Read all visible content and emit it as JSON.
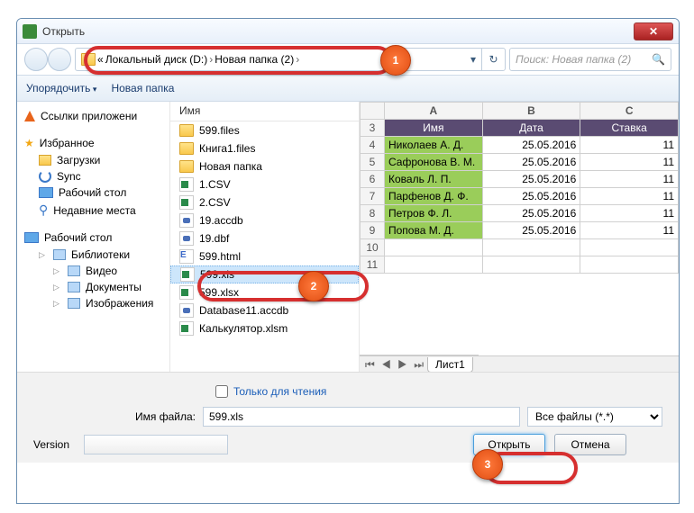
{
  "window": {
    "title": "Открыть"
  },
  "nav": {
    "prefix": "«",
    "seg1": "Локальный диск (D:)",
    "seg2": "Новая папка (2)",
    "sep": "›",
    "search_placeholder": "Поиск: Новая папка (2)"
  },
  "toolbar": {
    "organize": "Упорядочить",
    "newfolder": "Новая папка"
  },
  "sidebar": {
    "apps_header": "Ссылки приложени",
    "fav_header": "Избранное",
    "downloads": "Загрузки",
    "sync": "Sync",
    "desktop": "Рабочий стол",
    "recent": "Недавние места",
    "desk_header": "Рабочий стол",
    "libraries": "Библиотеки",
    "video": "Видео",
    "documents": "Документы",
    "pictures": "Изображения"
  },
  "filelist": {
    "col_name": "Имя",
    "rows": [
      {
        "icon": "folder",
        "name": "599.files"
      },
      {
        "icon": "folder",
        "name": "Книга1.files"
      },
      {
        "icon": "folder",
        "name": "Новая папка"
      },
      {
        "icon": "csv",
        "name": "1.CSV"
      },
      {
        "icon": "csv",
        "name": "2.CSV"
      },
      {
        "icon": "db",
        "name": "19.accdb"
      },
      {
        "icon": "db",
        "name": "19.dbf"
      },
      {
        "icon": "html",
        "name": "599.html"
      },
      {
        "icon": "xls",
        "name": "599.xls",
        "selected": true
      },
      {
        "icon": "xls",
        "name": "599.xlsx"
      },
      {
        "icon": "db",
        "name": "Database11.accdb"
      },
      {
        "icon": "xls",
        "name": "Калькулятор.xlsm"
      }
    ]
  },
  "preview": {
    "cols": [
      "A",
      "B",
      "C"
    ],
    "header_cells": [
      "Имя",
      "Дата",
      "Ставка"
    ],
    "rows": [
      {
        "n": 3,
        "header": true
      },
      {
        "n": 4,
        "name": "Николаев А. Д.",
        "date": "25.05.2016",
        "rate": "11"
      },
      {
        "n": 5,
        "name": "Сафронова В. М.",
        "date": "25.05.2016",
        "rate": "11"
      },
      {
        "n": 6,
        "name": "Коваль Л. П.",
        "date": "25.05.2016",
        "rate": "11"
      },
      {
        "n": 7,
        "name": "Парфенов Д. Ф.",
        "date": "25.05.2016",
        "rate": "11"
      },
      {
        "n": 8,
        "name": "Петров Ф. Л.",
        "date": "25.05.2016",
        "rate": "11"
      },
      {
        "n": 9,
        "name": "Попова М. Д.",
        "date": "25.05.2016",
        "rate": "11"
      },
      {
        "n": 10
      },
      {
        "n": 11
      }
    ],
    "sheet_tab": "Лист1"
  },
  "footer": {
    "readonly": "Только для чтения",
    "filename_label": "Имя файла:",
    "filename_value": "599.xls",
    "filter": "Все файлы (*.*)",
    "version_label": "Version",
    "open": "Открыть",
    "cancel": "Отмена"
  },
  "markers": {
    "m1": "1",
    "m2": "2",
    "m3": "3"
  }
}
